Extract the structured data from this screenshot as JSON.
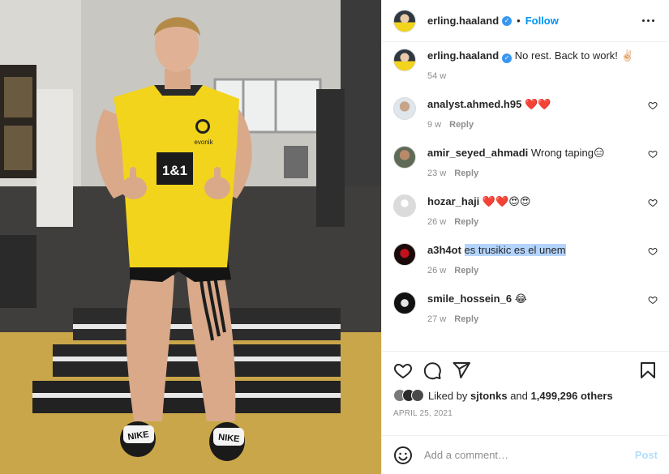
{
  "header": {
    "username": "erling.haaland",
    "verified": true,
    "follow_label": "Follow",
    "more_icon": "more-horizontal-icon"
  },
  "caption": {
    "username": "erling.haaland",
    "text": "No rest. Back to work! ✌🏻",
    "age": "54 w"
  },
  "comments": [
    {
      "username": "analyst.ahmed.h95",
      "text": "❤️❤️",
      "age": "9 w",
      "reply": "Reply"
    },
    {
      "username": "amir_seyed_ahmadi",
      "text": "Wrong taping😑",
      "age": "23 w",
      "reply": "Reply"
    },
    {
      "username": "hozar_haji",
      "text": "❤️❤️😍😍",
      "age": "26 w",
      "reply": "Reply"
    },
    {
      "username": "a3h4ot",
      "text": "es trusikic es el unem",
      "age": "26 w",
      "reply": "Reply"
    },
    {
      "username": "smile_hossein_6",
      "text": "😂",
      "age": "27 w",
      "reply": "Reply"
    }
  ],
  "likes": {
    "prefix": "Liked by",
    "user": "sjtonks",
    "joiner": "and",
    "count": "1,499,296 others"
  },
  "date": "APRIL 25, 2021",
  "add_comment": {
    "placeholder": "Add a comment…",
    "post_label": "Post"
  },
  "photo": {
    "shirt_text": "1&1",
    "brand": "evonik",
    "sandal_text_left": "NIKE",
    "sandal_text_right": "NIKE"
  },
  "colors": {
    "accent": "#0095f6",
    "post_disabled": "#b2dffc",
    "heart": "#ed4956",
    "muted": "#8e8e8e",
    "jersey": "#f2d41c"
  }
}
